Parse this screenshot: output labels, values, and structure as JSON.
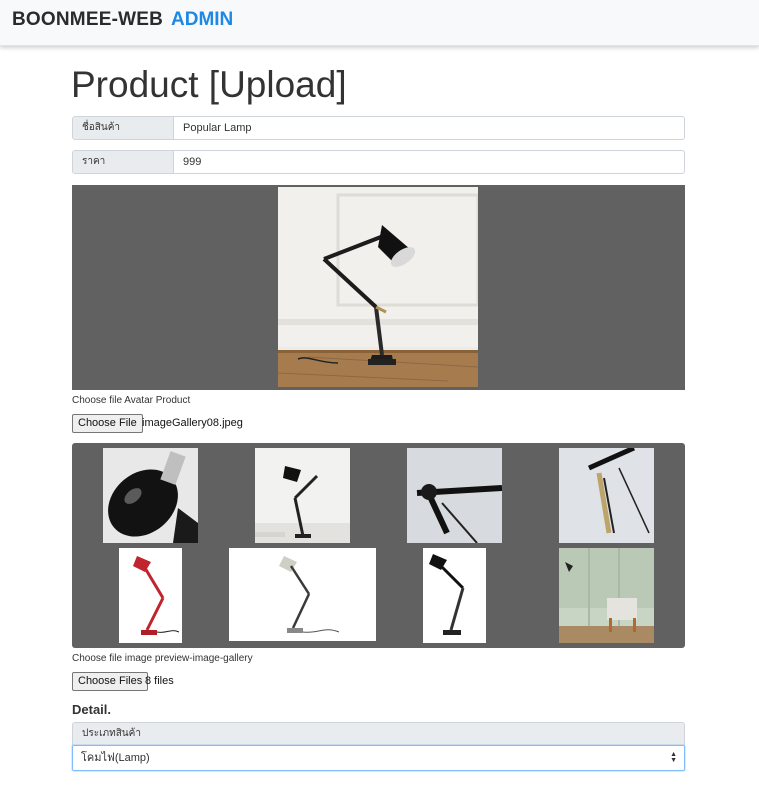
{
  "navbar": {
    "brand": "BOONMEE-WEB",
    "admin_link": "ADMIN"
  },
  "page_title": "Product [Upload]",
  "form": {
    "name_label": "ชื่อสินค้า",
    "name_value": "Popular Lamp",
    "price_label": "ราคา",
    "price_value": "999"
  },
  "avatar": {
    "choose_label": "Choose file Avatar Product",
    "button_label": "Choose File",
    "file_name": "imageGallery08.jpeg"
  },
  "gallery": {
    "choose_label": "Choose file image preview-image-gallery",
    "button_label": "Choose Files",
    "file_count": "8 files"
  },
  "detail": {
    "title": "Detail.",
    "category_label": "ประเภทสินค้า",
    "category_value": "โคมไฟ(Lamp)"
  },
  "icons": {
    "select_arrow": "select-arrows-icon"
  },
  "colors": {
    "accent": "#1e88e5",
    "panel_bg": "#616161",
    "navbar_bg": "#f8f9fa"
  }
}
